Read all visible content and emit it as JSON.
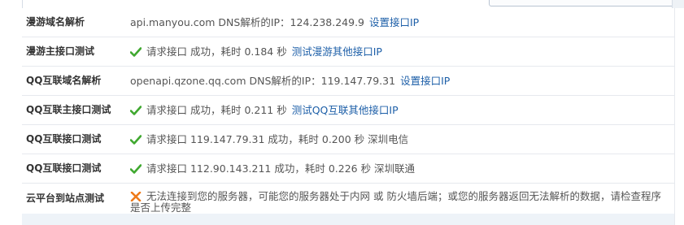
{
  "rows": [
    {
      "label": "漫游域名解析",
      "text": "api.manyou.com DNS解析的IP：124.238.249.9",
      "link": "设置接口IP"
    },
    {
      "label": "漫游主接口测试",
      "icon": "check-icon",
      "text": "请求接口 成功，耗时 0.184 秒",
      "link": "测试漫游其他接口IP"
    },
    {
      "label": "QQ互联域名解析",
      "text": "openapi.qzone.qq.com DNS解析的IP：119.147.79.31",
      "link": "设置接口IP"
    },
    {
      "label": "QQ互联主接口测试",
      "icon": "check-icon",
      "text": "请求接口 成功，耗时 0.211 秒",
      "link": "测试QQ互联其他接口IP"
    },
    {
      "label": "QQ互联接口测试",
      "icon": "check-icon",
      "text": "请求接口 119.147.79.31 成功，耗时 0.200 秒 深圳电信"
    },
    {
      "label": "QQ互联接口测试",
      "icon": "check-icon",
      "text": "请求接口 112.90.143.211 成功，耗时 0.226 秒 深圳联通"
    },
    {
      "label": "云平台到站点测试",
      "icon": "cross-icon",
      "text": "无法连接到您的服务器，可能您的服务器处于内网 或 防火墙后端；或您的服务器返回无法解析的数据，请检查程序是否上传完整"
    }
  ],
  "colors": {
    "success": "#3fa82f",
    "error": "#ef7a1a",
    "link": "#1d5fa8",
    "border": "#e6e9ee",
    "footer": "#eef3f8"
  }
}
